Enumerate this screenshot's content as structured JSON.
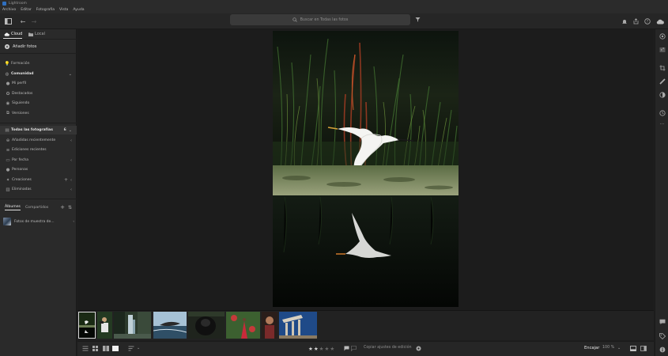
{
  "window": {
    "title": "Lightroom"
  },
  "menu": [
    "Archivo",
    "Editar",
    "Fotografía",
    "Vista",
    "Ayuda"
  ],
  "search": {
    "placeholder": "Buscar en Todas las fotos"
  },
  "sidebar": {
    "tabs": {
      "cloud": "Cloud",
      "local": "Local"
    },
    "add_photos": "Añadir fotos",
    "learn": "Formación",
    "community": {
      "label": "Comunidad",
      "items": [
        "Mi perfil",
        "Destacados",
        "Siguiendo",
        "Versiones"
      ]
    },
    "all_photos": {
      "label": "Todas las fotografías",
      "count": "6",
      "items": [
        "Añadidas recientemente",
        "Ediciones recientes",
        "Por fecha",
        "Personas",
        "Creaciones",
        "Eliminadas"
      ]
    },
    "albums_tab": "Álbumes",
    "shared_tab": "Compartidos",
    "album_name": "Fotos de muestra de..."
  },
  "bottom": {
    "rating_stars_filled": 2,
    "rating_stars_total": 5,
    "copy_settings": "Copiar ajustes de edición",
    "fit": "Encajar",
    "zoom": "100 %"
  },
  "colors": {
    "accent": "#2f6fbf",
    "panel": "#2a2a2a",
    "background": "#1c1c1c"
  },
  "icons": {
    "toolbar": [
      "panel-toggle-icon",
      "back-icon",
      "forward-icon",
      "bell-icon",
      "share-icon",
      "help-icon",
      "cloud-icon"
    ],
    "rightbar": [
      "edit-icon",
      "sliders-icon",
      "crop-icon",
      "heal-icon",
      "mask-icon",
      "history-icon",
      "more-icon",
      "comment-icon",
      "tag-icon"
    ]
  }
}
